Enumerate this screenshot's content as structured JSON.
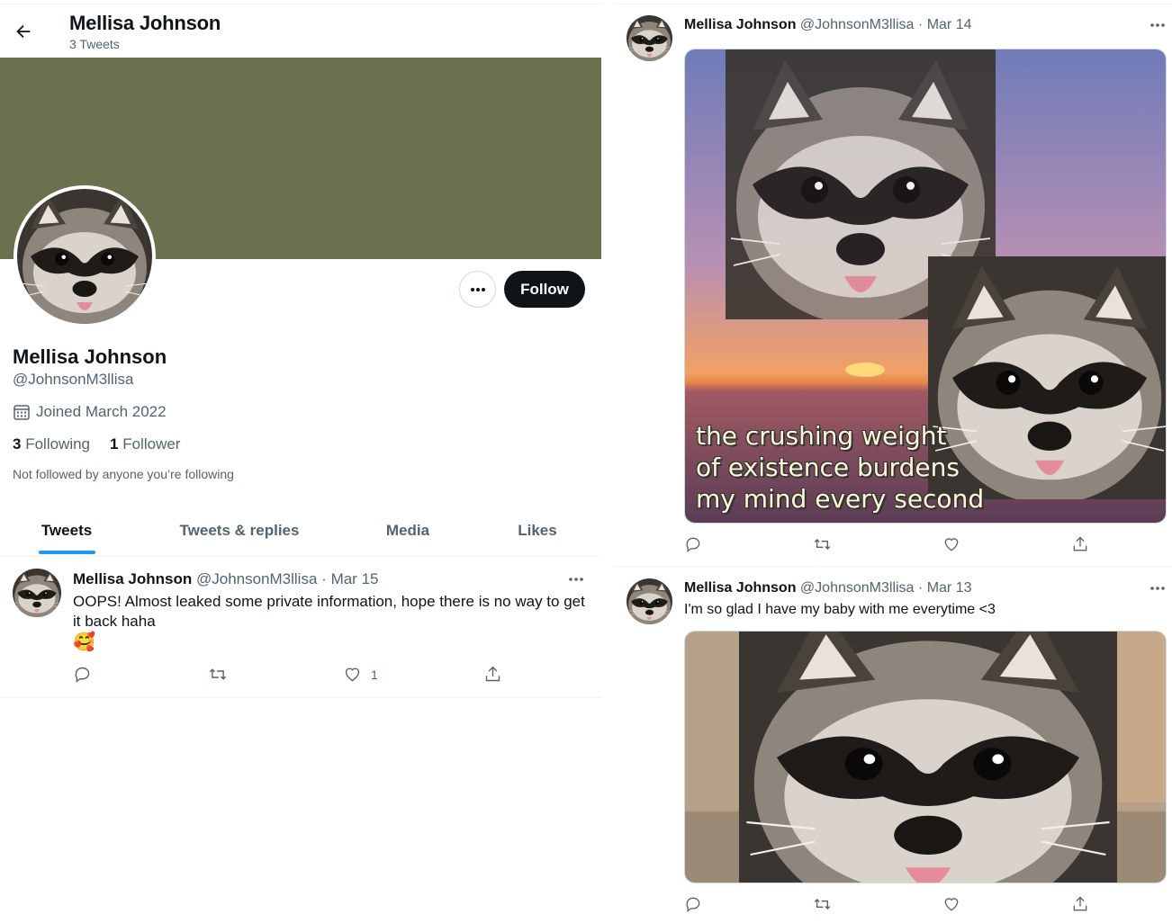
{
  "header": {
    "name": "Mellisa Johnson",
    "tweet_count": "3 Tweets"
  },
  "profile": {
    "name": "Mellisa Johnson",
    "handle": "@JohnsonM3llisa",
    "joined": "Joined March 2022",
    "following_count": "3",
    "following_label": "Following",
    "followers_count": "1",
    "followers_label": "Follower",
    "not_followed": "Not followed by anyone you’re following",
    "follow_label": "Follow",
    "banner_color": "#6b714f"
  },
  "tabs": [
    {
      "label": "Tweets"
    },
    {
      "label": "Tweets & replies"
    },
    {
      "label": "Media"
    },
    {
      "label": "Likes"
    }
  ],
  "tweets": [
    {
      "name": "Mellisa Johnson",
      "handle": "@JohnsonM3llisa",
      "date": "Mar 15",
      "text": "OOPS! Almost leaked some private information, hope there is no way to get it back haha",
      "emoji": "🥰",
      "likes": "1"
    },
    {
      "name": "Mellisa Johnson",
      "handle": "@JohnsonM3llisa",
      "date": "Mar 14",
      "image_caption": [
        "the crushing weight",
        "of existence burdens",
        "my mind every second"
      ]
    },
    {
      "name": "Mellisa Johnson",
      "handle": "@JohnsonM3llisa",
      "date": "Mar 13",
      "text": "I'm so glad I have my baby with me everytime <3"
    }
  ],
  "icons": {
    "back": "arrow-left-icon",
    "more": "ellipsis-icon",
    "calendar": "calendar-icon",
    "reply": "reply-icon",
    "retweet": "retweet-icon",
    "like": "heart-icon",
    "share": "share-icon"
  },
  "colors": {
    "accent": "#1d9bf0",
    "text": "#0f1419",
    "muted": "#536471"
  }
}
